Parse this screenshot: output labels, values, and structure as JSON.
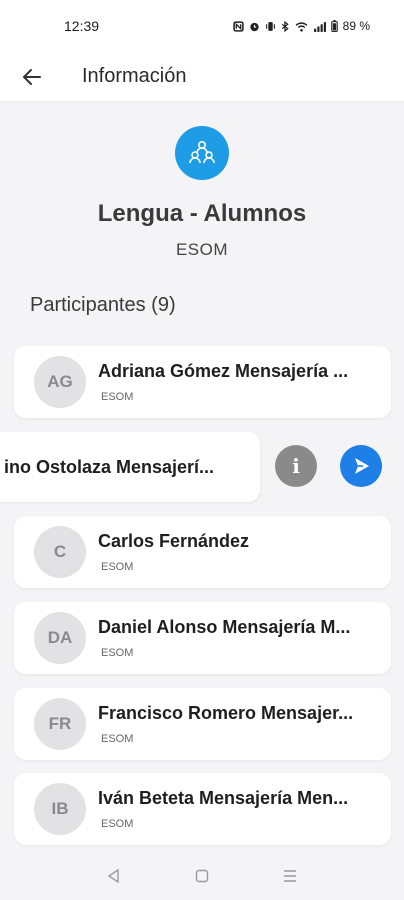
{
  "status": {
    "time": "12:39",
    "battery": "89 %"
  },
  "header": {
    "title": "Información"
  },
  "group": {
    "name": "Lengua - Alumnos",
    "org": "ESOM"
  },
  "participants": {
    "title": "Participantes (9)",
    "items": [
      {
        "initials": "AG",
        "name": "Adriana Gómez Mensajería ...",
        "org": "ESOM"
      },
      {
        "initials": "",
        "name": "ino Ostolaza Mensajerí...",
        "org": ""
      },
      {
        "initials": "C",
        "name": "Carlos  Fernández",
        "org": "ESOM"
      },
      {
        "initials": "DA",
        "name": "Daniel Alonso Mensajería M...",
        "org": "ESOM"
      },
      {
        "initials": "FR",
        "name": "Francisco Romero Mensajer...",
        "org": "ESOM"
      },
      {
        "initials": "IB",
        "name": "Iván Beteta Mensajería Men...",
        "org": "ESOM"
      }
    ]
  },
  "swipe_actions": {
    "info_glyph": "i"
  },
  "colors": {
    "accent": "#1e9de6",
    "send": "#1e7fe6",
    "info": "#8a8a8a"
  }
}
